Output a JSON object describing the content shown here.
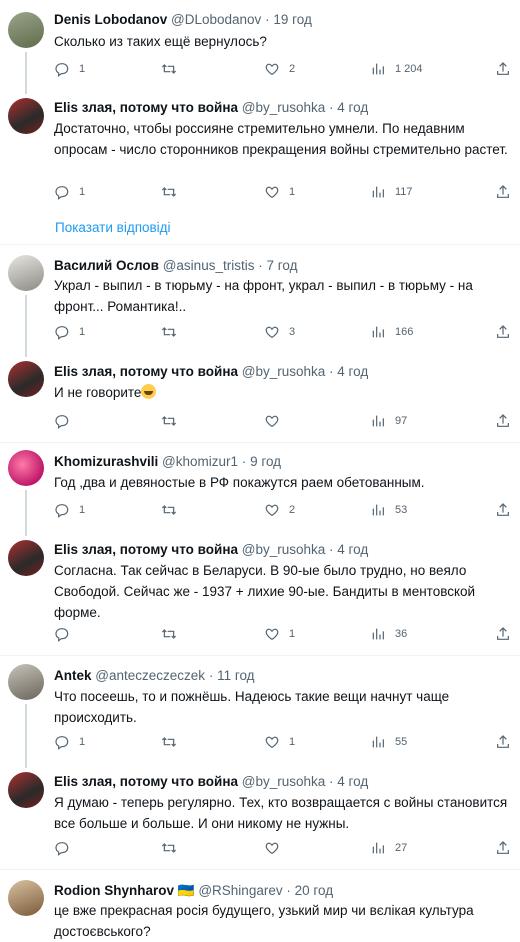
{
  "colors": {
    "link": "#1d9bf0",
    "muted": "#536471",
    "text": "#0f1419"
  },
  "tweets": [
    {
      "name": "Denis Lobodanov",
      "handle": "@DLobodanov",
      "time": "19 год",
      "text": "Сколько из таких ещё вернулось?",
      "replies": "1",
      "retweets": "",
      "likes": "2",
      "views": "1 204"
    },
    {
      "name": "Elis злая, потому что война",
      "handle": "@by_rusohka",
      "time": "4 год",
      "text": "Достаточно, чтобы россияне стремительно умнели. По недавним опросам - число сторонников прекращения войны стремительно растет.",
      "replies": "1",
      "retweets": "",
      "likes": "1",
      "views": "117"
    },
    {
      "name": "Василий Ослов",
      "handle": "@asinus_tristis",
      "time": "7 год",
      "text": "Украл - выпил - в тюрьму - на фронт, украл - выпил - в тюрьму - на фронт... Романтика!..",
      "replies": "1",
      "retweets": "",
      "likes": "3",
      "views": "166"
    },
    {
      "name": "Elis злая, потому что война",
      "handle": "@by_rusohka",
      "time": "4 год",
      "text": "И не говорите",
      "replies": "",
      "retweets": "",
      "likes": "",
      "views": "97"
    },
    {
      "name": "Khomizurashvili",
      "handle": "@khomizur1",
      "time": "9 год",
      "text": "Год ,два и девяностые в РФ покажутся раем обетованным.",
      "replies": "1",
      "retweets": "",
      "likes": "2",
      "views": "53"
    },
    {
      "name": "Elis злая, потому что война",
      "handle": "@by_rusohka",
      "time": "4 год",
      "text": "Согласна. Так сейчас в Беларуси. В 90-ые было трудно, но веяло Свободой. Сейчас же - 1937 + лихие 90-ые. Бандиты в ментовской форме.",
      "replies": "",
      "retweets": "",
      "likes": "1",
      "views": "36"
    },
    {
      "name": "Antek",
      "handle": "@anteczeczeczek",
      "time": "11 год",
      "text": "Что посеешь, то и пожнёшь. Надеюсь такие вещи начнут чаще происходить.",
      "replies": "1",
      "retweets": "",
      "likes": "1",
      "views": "55"
    },
    {
      "name": "Elis злая, потому что война",
      "handle": "@by_rusohka",
      "time": "4 год",
      "text": "Я думаю - теперь регулярно. Тех, кто возвращается с войны становится все больше и больше. И они никому не нужны.",
      "replies": "",
      "retweets": "",
      "likes": "",
      "views": "27"
    },
    {
      "name": "Rodion Shynharov 🇺🇦",
      "handle": "@RShingarev",
      "time": "20 год",
      "text": "це вже прекрасная росія будущего, узький мир чи вєлікая культура достоєвського?"
    }
  ],
  "show_replies": "Показати відповіді"
}
